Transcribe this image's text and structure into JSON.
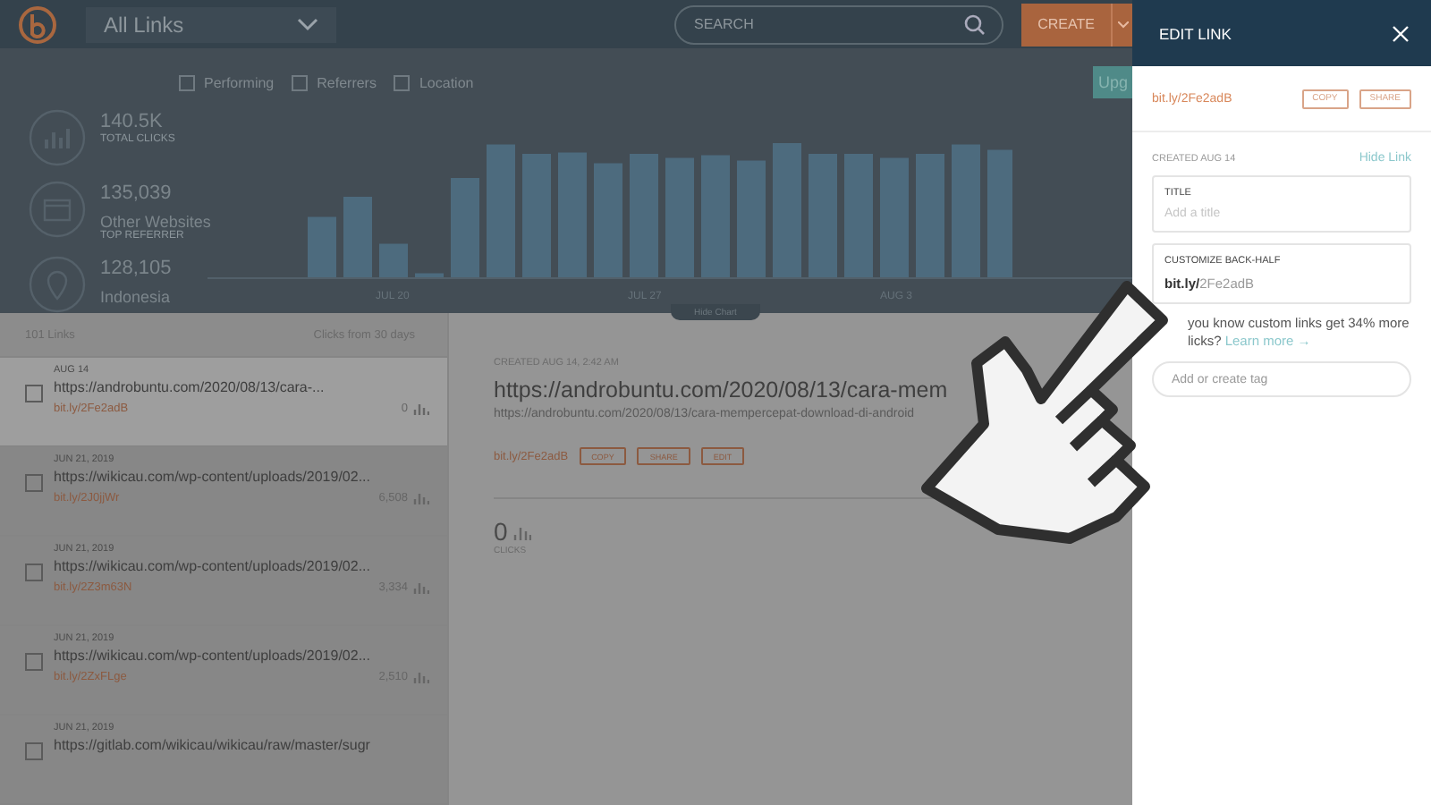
{
  "topbar": {
    "group_select": "All Links",
    "search": {
      "placeholder": "SEARCH"
    },
    "create_button": "CREATE"
  },
  "filters": [
    {
      "label": "Performing",
      "checked": false
    },
    {
      "label": "Referrers",
      "checked": false
    },
    {
      "label": "Location",
      "checked": false
    }
  ],
  "upgrade_button": "Upg",
  "stats": [
    {
      "value": "140.5K",
      "caption": "TOTAL CLICKS"
    },
    {
      "value": "135,039",
      "label": "Other Websites",
      "caption": "TOP REFERRER"
    },
    {
      "value": "128,105",
      "label": "Indonesia"
    }
  ],
  "chart_axis_labels": [
    "JUL 20",
    "JUL 27",
    "AUG 3"
  ],
  "hide_chart": "Hide Chart",
  "list": {
    "count": "101 Links",
    "clicks_header": "Clicks from 30 days",
    "items": [
      {
        "date": "AUG 14",
        "url": "https://androbuntu.com/2020/08/13/cara-...",
        "short": "bit.ly/2Fe2adB",
        "clicks": "0",
        "selected": true
      },
      {
        "date": "JUN 21, 2019",
        "url": "https://wikicau.com/wp-content/uploads/2019/02...",
        "short": "bit.ly/2J0jjWr",
        "clicks": "6,508",
        "selected": false
      },
      {
        "date": "JUN 21, 2019",
        "url": "https://wikicau.com/wp-content/uploads/2019/02...",
        "short": "bit.ly/2Z3m63N",
        "clicks": "3,334",
        "selected": false
      },
      {
        "date": "JUN 21, 2019",
        "url": "https://wikicau.com/wp-content/uploads/2019/02...",
        "short": "bit.ly/2ZxFLge",
        "clicks": "2,510",
        "selected": false
      },
      {
        "date": "JUN 21, 2019",
        "url": "https://gitlab.com/wikicau/wikicau/raw/master/sugr",
        "selected": false
      }
    ]
  },
  "detail": {
    "created": "CREATED AUG 14, 2:42 AM",
    "title": "https://androbuntu.com/2020/08/13/cara-mem",
    "long_url": "https://androbuntu.com/2020/08/13/cara-mempercepat-download-di-android",
    "short": "bit.ly/2Fe2adB",
    "buttons": [
      "COPY",
      "SHARE",
      "EDIT"
    ],
    "clicks": "0",
    "clicks_label": "CLICKS"
  },
  "edit_panel": {
    "title": "EDIT LINK",
    "short": "bit.ly/2Fe2adB",
    "buttons": [
      "COPY",
      "SHARE"
    ],
    "created": "CREATED AUG 14",
    "hide_link": "Hide Link",
    "title_field": {
      "label": "TITLE",
      "placeholder": "Add a title"
    },
    "backhalf_field": {
      "label": "CUSTOMIZE BACK-HALF",
      "prefix": "bit.ly/",
      "value": "2Fe2adB"
    },
    "tip": "you know custom links get 34% more licks?",
    "learn_more": "Learn more →",
    "tag_field": {
      "placeholder": "Add or create tag"
    }
  }
}
